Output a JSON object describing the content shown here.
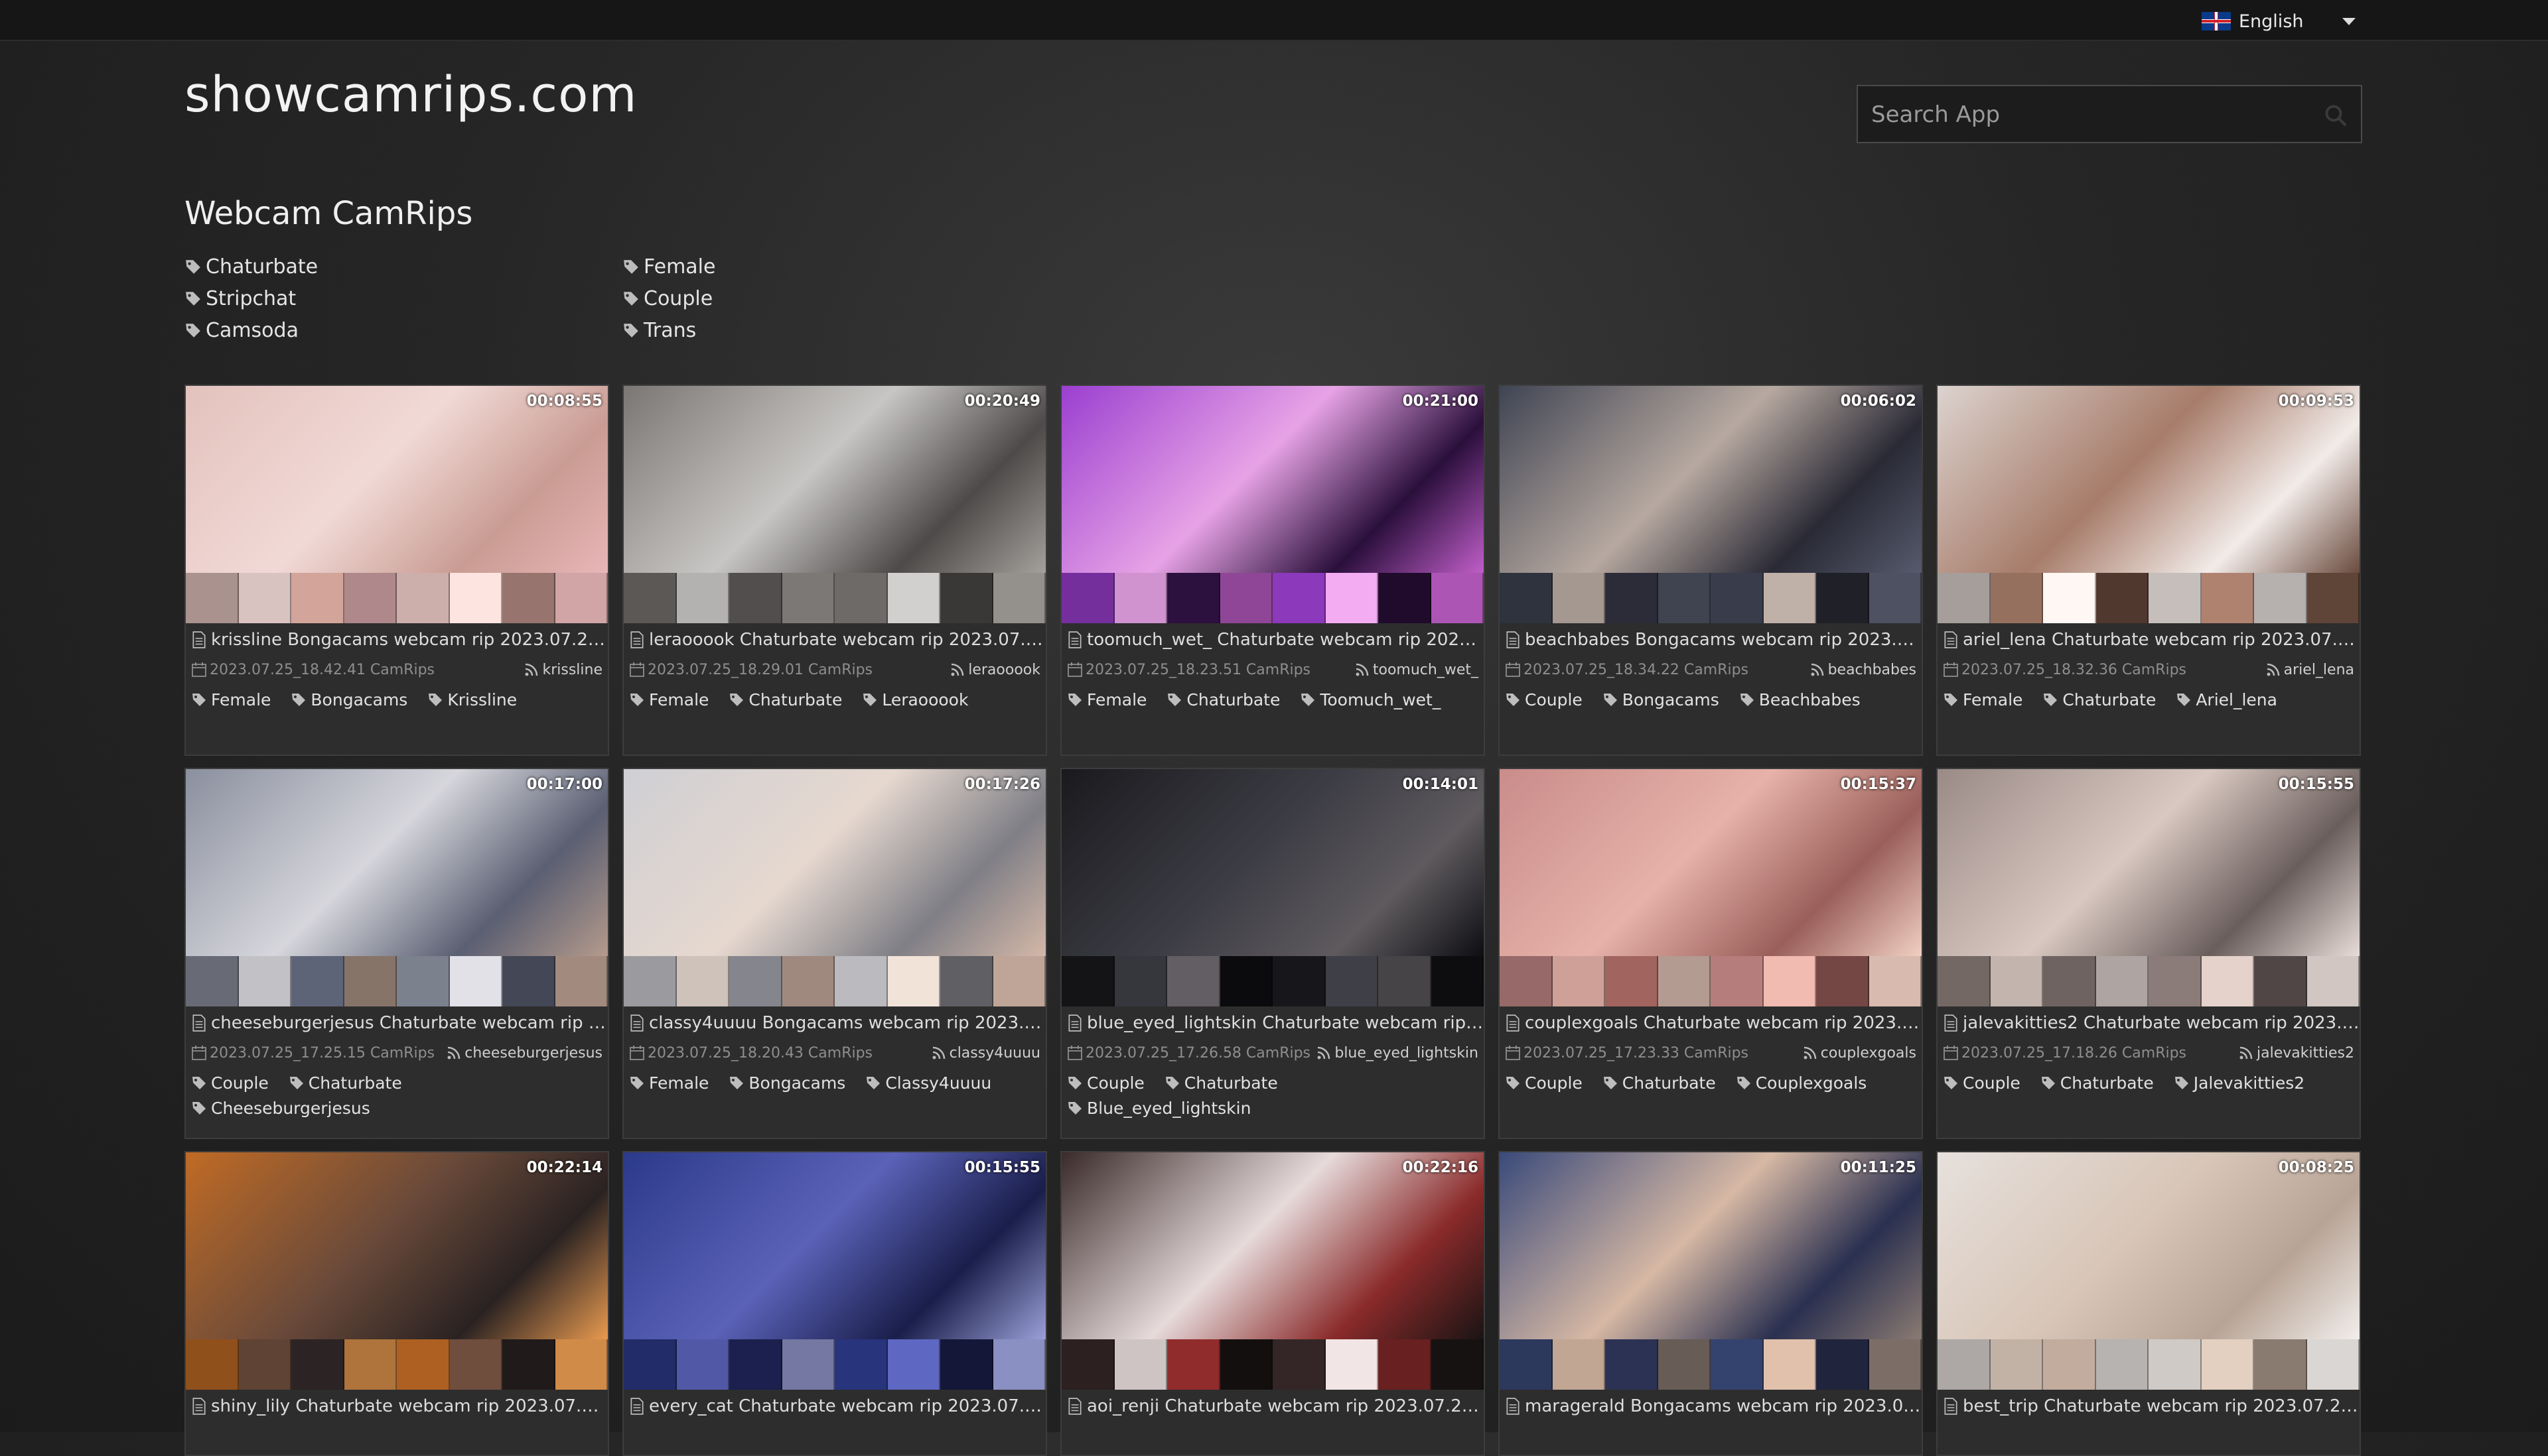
{
  "header": {
    "language": "English",
    "site_title": "showcamrips.com",
    "search_placeholder": "Search App"
  },
  "section": {
    "title": "Webcam CamRips",
    "categories_col1": [
      "Chaturbate",
      "Stripchat",
      "Camsoda"
    ],
    "categories_col2": [
      "Female",
      "Couple",
      "Trans"
    ]
  },
  "videos": [
    {
      "duration": "00:08:55",
      "title": "krissline Bongacams webcam rip 2023.07.25_...",
      "date": "2023.07.25_18.42.41 CamRips",
      "performer": "krissline",
      "tags": [
        "Female",
        "Bongacams",
        "Krissline"
      ],
      "colors": [
        "#e3c2bd",
        "#f1d9d6",
        "#c99c93",
        "#e8b6b8"
      ]
    },
    {
      "duration": "00:20:49",
      "title": "leraooook Chaturbate webcam rip 2023.07.25...",
      "date": "2023.07.25_18.29.01 CamRips",
      "performer": "leraooook",
      "tags": [
        "Female",
        "Chaturbate",
        "Leraooook"
      ],
      "colors": [
        "#7a7673",
        "#c8c6c4",
        "#4d4a49",
        "#a4a09c"
      ]
    },
    {
      "duration": "00:21:00",
      "title": "toomuch_wet_ Chaturbate webcam rip 2023.0...",
      "date": "2023.07.25_18.23.51 CamRips",
      "performer": "toomuch_wet_",
      "tags": [
        "Female",
        "Chaturbate",
        "Toomuch_wet_"
      ],
      "colors": [
        "#9b3fd0",
        "#e7a3e6",
        "#2a0f3b",
        "#c05ec9"
      ]
    },
    {
      "duration": "00:06:02",
      "title": "beachbabes Bongacams webcam rip 2023.07....",
      "date": "2023.07.25_18.34.22 CamRips",
      "performer": "beachbabes",
      "tags": [
        "Couple",
        "Bongacams",
        "Beachbabes"
      ],
      "colors": [
        "#3f4453",
        "#b7a9a0",
        "#2a2a36",
        "#565a6c"
      ]
    },
    {
      "duration": "00:09:53",
      "title": "ariel_lena Chaturbate webcam rip 2023.07.25_...",
      "date": "2023.07.25_18.32.36 CamRips",
      "performer": "ariel_lena",
      "tags": [
        "Female",
        "Chaturbate",
        "Ariel_lena"
      ],
      "colors": [
        "#dcd3cf",
        "#a77c6a",
        "#f2ebe8",
        "#6a4b3e"
      ]
    },
    {
      "duration": "00:17:00",
      "title": "cheeseburgerjesus Chaturbate webcam rip 20...",
      "date": "2023.07.25_17.25.15 CamRips",
      "performer": "cheeseburgerjesus",
      "tags": [
        "Couple",
        "Chaturbate",
        "Cheeseburgerjesus"
      ],
      "colors": [
        "#8a8f9e",
        "#d6d6dc",
        "#5a5f72",
        "#b49a8c"
      ]
    },
    {
      "duration": "00:17:26",
      "title": "classy4uuuu Bongacams webcam rip 2023.07....",
      "date": "2023.07.25_18.20.43 CamRips",
      "performer": "classy4uuuu",
      "tags": [
        "Female",
        "Bongacams",
        "Classy4uuuu"
      ],
      "colors": [
        "#cfcfd4",
        "#e6d8cf",
        "#7f7f86",
        "#d4b7a8"
      ]
    },
    {
      "duration": "00:14:01",
      "title": "blue_eyed_lightskin Chaturbate webcam rip 20...",
      "date": "2023.07.25_17.26.58 CamRips",
      "performer": "blue_eyed_lightskin",
      "tags": [
        "Couple",
        "Chaturbate",
        "Blue_eyed_lightskin"
      ],
      "colors": [
        "#1a1a1e",
        "#3c3c44",
        "#5e5a5e",
        "#0e0e12"
      ]
    },
    {
      "duration": "00:15:37",
      "title": "couplexgoals Chaturbate webcam rip 2023.07....",
      "date": "2023.07.25_17.23.33 CamRips",
      "performer": "couplexgoals",
      "tags": [
        "Couple",
        "Chaturbate",
        "Couplexgoals"
      ],
      "colors": [
        "#c98c8a",
        "#e6b2a9",
        "#9a5f5a",
        "#f0cfc1"
      ]
    },
    {
      "duration": "00:15:55",
      "title": "jalevakitties2 Chaturbate webcam rip 2023.07....",
      "date": "2023.07.25_17.18.26 CamRips",
      "performer": "jalevakitties2",
      "tags": [
        "Couple",
        "Chaturbate",
        "Jalevakitties2"
      ],
      "colors": [
        "#9a8a86",
        "#d9c8c1",
        "#6a5e5c",
        "#e8dcd8"
      ]
    },
    {
      "duration": "00:22:14",
      "title": "shiny_lily Chaturbate webcam rip 2023.07.25_...",
      "date": "",
      "performer": "",
      "tags": [],
      "colors": [
        "#c06b25",
        "#6a4a3a",
        "#2a2222",
        "#e89a50"
      ]
    },
    {
      "duration": "00:15:55",
      "title": "every_cat Chaturbate webcam rip 2023.07.25_...",
      "date": "",
      "performer": "",
      "tags": [],
      "colors": [
        "#2c3a8a",
        "#5a62b8",
        "#1a1e4a",
        "#9aa0d8"
      ]
    },
    {
      "duration": "00:22:16",
      "title": "aoi_renji Chaturbate webcam rip 2023.07.25_1...",
      "date": "",
      "performer": "",
      "tags": [],
      "colors": [
        "#3a2a2a",
        "#e6dada",
        "#8a2a2a",
        "#1a1414"
      ]
    },
    {
      "duration": "00:11:25",
      "title": "maragerald Bongacams webcam rip 2023.07.2...",
      "date": "",
      "performer": "",
      "tags": [],
      "colors": [
        "#3a4a7a",
        "#d6b8a4",
        "#2a3050",
        "#8a7a72"
      ]
    },
    {
      "duration": "00:08:25",
      "title": "best_trip Chaturbate webcam rip 2023.07.25_...",
      "date": "",
      "performer": "",
      "tags": [],
      "colors": [
        "#e6e0dc",
        "#d8c6b8",
        "#b8a496",
        "#f2eeec"
      ]
    }
  ]
}
